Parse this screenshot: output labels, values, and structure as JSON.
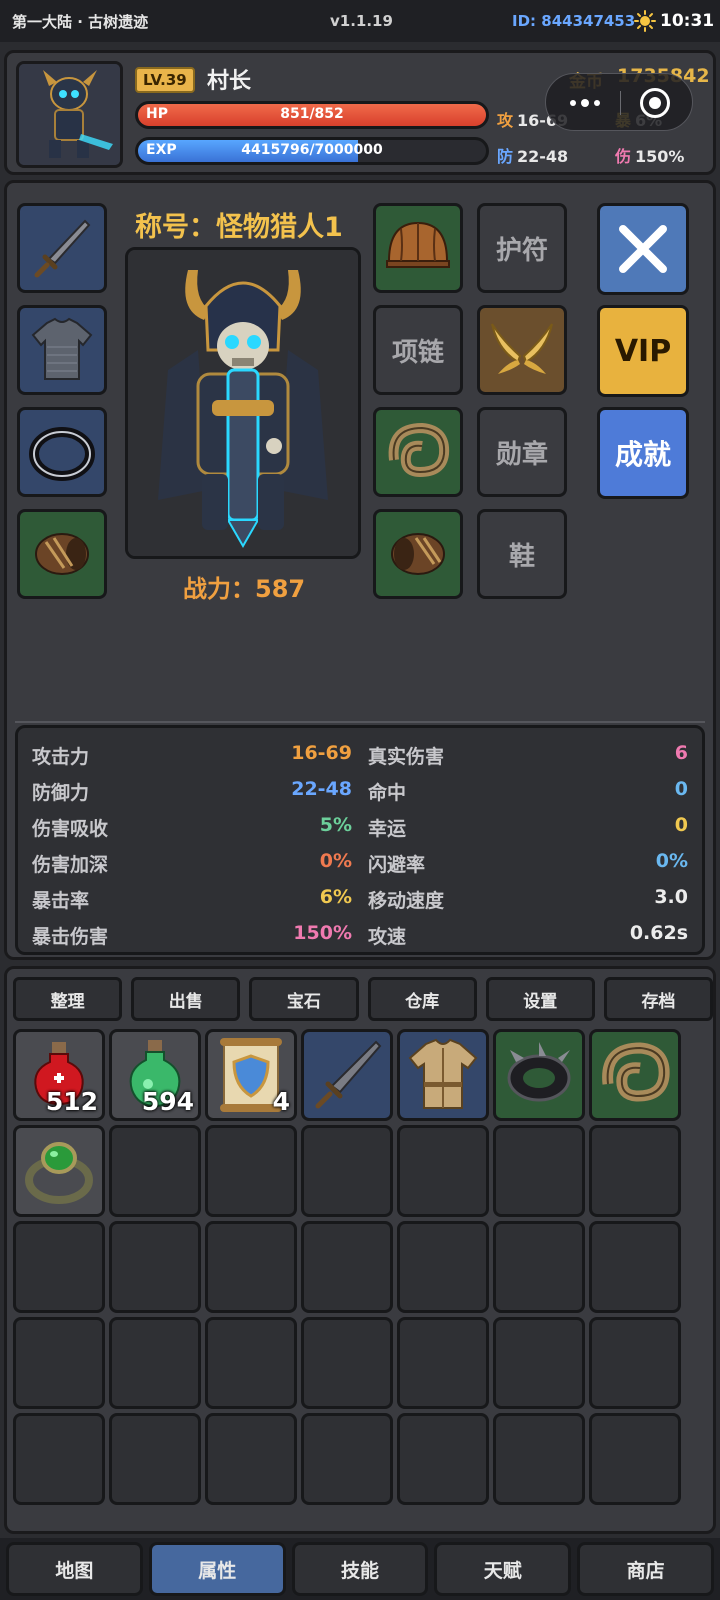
{
  "topbar": {
    "location": "第一大陆 · 古树遗迹",
    "version": "v1.1.19",
    "user_id": "ID: 844347453",
    "time": "10:31"
  },
  "player": {
    "level": "LV.39",
    "name": "村长",
    "hp_label": "HP",
    "hp_value": "851/852",
    "hp_fraction": 0.9988,
    "exp_label": "EXP",
    "exp_value": "4415796/7000000",
    "exp_fraction": 0.6308,
    "gold_label": "金币",
    "gold_value": "1735842",
    "atk_label": "攻",
    "atk_value": "16-69",
    "crit_label": "暴",
    "crit_value": "6%",
    "def_label": "防",
    "def_value": "22-48",
    "dmg_label": "伤",
    "dmg_value": "150%"
  },
  "equipment": {
    "title": "称号：怪物猎人1",
    "power": "战力：587",
    "slots": {
      "amulet": "护符",
      "necklace": "项链",
      "medal": "勋章",
      "shoes": "鞋"
    },
    "vip_label": "VIP",
    "achievement_label": "成就"
  },
  "stats": {
    "left": [
      {
        "label": "攻击力",
        "value": "16-69"
      },
      {
        "label": "防御力",
        "value": "22-48"
      },
      {
        "label": "伤害吸收",
        "value": "5%"
      },
      {
        "label": "伤害加深",
        "value": "0%"
      },
      {
        "label": "暴击率",
        "value": "6%"
      },
      {
        "label": "暴击伤害",
        "value": "150%"
      }
    ],
    "right": [
      {
        "label": "真实伤害",
        "value": "6"
      },
      {
        "label": "命中",
        "value": "0"
      },
      {
        "label": "幸运",
        "value": "0"
      },
      {
        "label": "闪避率",
        "value": "0%"
      },
      {
        "label": "移动速度",
        "value": "3.0"
      },
      {
        "label": "攻速",
        "value": "0.62s"
      }
    ]
  },
  "inventory": {
    "tabs": [
      "整理",
      "出售",
      "宝石",
      "仓库",
      "设置",
      "存档"
    ],
    "items": [
      {
        "icon": "red-potion-icon",
        "count": "512"
      },
      {
        "icon": "green-potion-icon",
        "count": "594"
      },
      {
        "icon": "shield-scroll-icon",
        "count": "4"
      },
      {
        "icon": "sword-icon",
        "count": ""
      },
      {
        "icon": "cloth-armor-icon",
        "count": ""
      },
      {
        "icon": "spiked-ring-icon",
        "count": ""
      },
      {
        "icon": "horn-ring-icon",
        "count": ""
      },
      {
        "icon": "emerald-ring-icon",
        "count": ""
      }
    ]
  },
  "nav": [
    "地图",
    "属性",
    "技能",
    "天赋",
    "商店"
  ],
  "colors": {
    "accent_gold": "#e6b649",
    "hp_red": "#d8402c",
    "exp_blue": "#3a72d6",
    "active_tab": "#46689e",
    "vip_gold": "#e8b23e"
  }
}
